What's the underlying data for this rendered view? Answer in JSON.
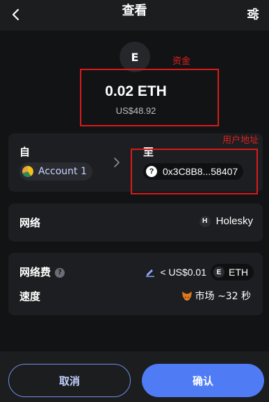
{
  "header": {
    "title": "查看",
    "back_icon": "chevron-left-icon",
    "settings_icon": "sliders-icon"
  },
  "token": {
    "avatar_letter": "E",
    "amount": "0.02 ETH",
    "fiat": "US$48.92"
  },
  "annotations": {
    "funds_label": "资金",
    "address_label": "用户地址",
    "color": "#e02020"
  },
  "from_to": {
    "from_label": "自",
    "to_label": "至",
    "account_name": "Account 1",
    "to_address": "0x3C8B8...58407",
    "to_badge": "?"
  },
  "network": {
    "label": "网络",
    "badge": "H",
    "name": "Holesky"
  },
  "fee": {
    "label": "网络费",
    "info_badge": "?",
    "value": "< US$0.01",
    "token_badge": "E",
    "token": "ETH"
  },
  "speed": {
    "label": "速度",
    "value": "市场 ~32 秒"
  },
  "footer": {
    "cancel_label": "取消",
    "confirm_label": "确认",
    "accent": "#4f7bf5"
  }
}
